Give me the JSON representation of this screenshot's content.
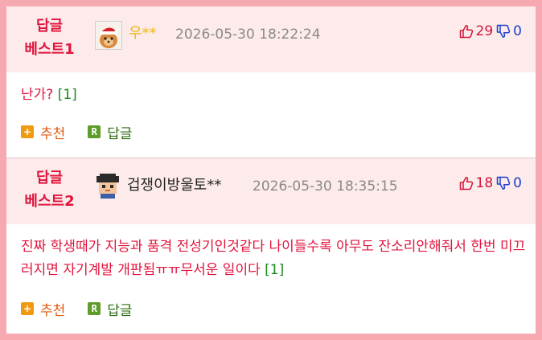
{
  "comments": [
    {
      "badge_line1": "답글",
      "badge_line2": "베스트1",
      "nickname": "우**",
      "nickname_color": "#f2b705",
      "avatar": "dog-with-santa-hat-icon",
      "timestamp": "2026-05-30 18:22:24",
      "upvotes": "29",
      "downvotes": "0",
      "text": "난가?",
      "reply_count": "[1]",
      "recommend_label": "추천",
      "reply_label": "답글"
    },
    {
      "badge_line1": "답글",
      "badge_line2": "베스트2",
      "nickname": "겁쟁이방울토**",
      "nickname_color": "#222222",
      "avatar": "pixel-character-icon",
      "timestamp": "2026-05-30 18:35:15",
      "upvotes": "18",
      "downvotes": "0",
      "text": "진짜 학생때가 지능과 품격 전성기인것같다 나이들수록 아무도 잔소리안해줘서 한번 미끄러지면 자기계발 개판됨ㅠㅠ무서운 일이다",
      "reply_count": "[1]",
      "recommend_label": "추천",
      "reply_label": "답글"
    }
  ],
  "icons": {
    "thumbs_up": "thumbs-up-icon",
    "thumbs_down": "thumbs-down-icon",
    "recommend": "plus-icon",
    "reply": "r-icon"
  },
  "icon_glyphs": {
    "recommend": "+",
    "reply": "R"
  },
  "colors": {
    "frame": "#f6a9b0",
    "header_bg": "#fdeaea",
    "badge": "#e0143c",
    "upvote": "#d2143a",
    "downvote": "#1f3ecf",
    "reply_count": "#1a8a1a"
  }
}
